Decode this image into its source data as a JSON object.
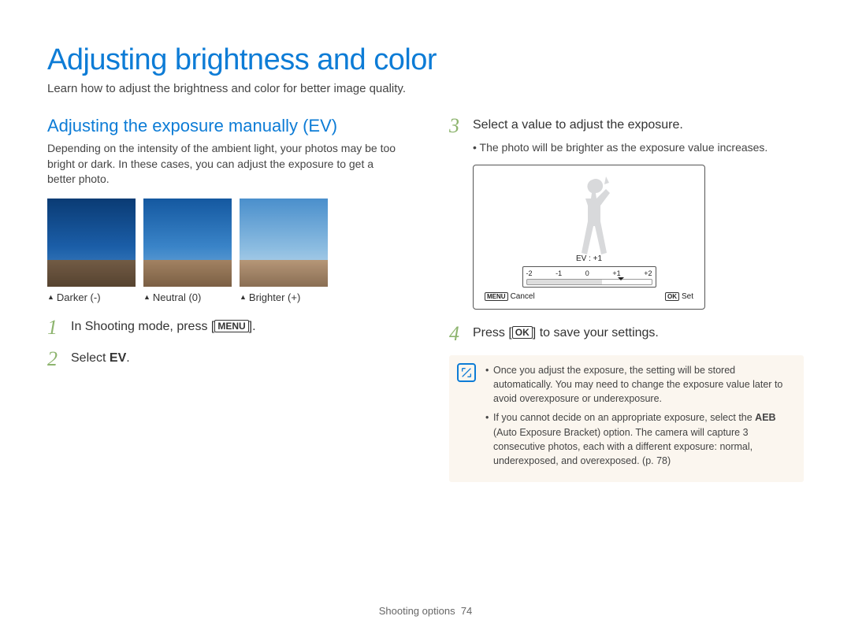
{
  "title": "Adjusting brightness and color",
  "intro": "Learn how to adjust the brightness and color for better image quality.",
  "left": {
    "section_title": "Adjusting the exposure manually (EV)",
    "desc": "Depending on the intensity of the ambient light, your photos may be too bright or dark. In these cases, you can adjust the exposure to get a better photo.",
    "captions": {
      "darker": "Darker (-)",
      "neutral": "Neutral (0)",
      "brighter": "Brighter (+)"
    },
    "step1": {
      "num": "1",
      "pre": "In Shooting mode, press [",
      "btn": "MENU",
      "post": "]."
    },
    "step2": {
      "num": "2",
      "pre": "Select ",
      "bold": "EV",
      "post": "."
    }
  },
  "right": {
    "step3": {
      "num": "3",
      "text": "Select a value to adjust the exposure.",
      "bullet": "The photo will be brighter as the exposure value increases."
    },
    "screen": {
      "ev_label": "EV : +1",
      "ticks": [
        "-2",
        "-1",
        "0",
        "+1",
        "+2"
      ],
      "cancel_btn": "MENU",
      "cancel": "Cancel",
      "set_btn": "OK",
      "set": "Set"
    },
    "step4": {
      "num": "4",
      "pre": "Press [",
      "btn": "OK",
      "post": "] to save your settings."
    },
    "note": {
      "item1": "Once you adjust the exposure, the setting will be stored automatically. You may need to change the exposure value later to avoid overexposure or underexposure.",
      "item2_a": "If you cannot decide on an appropriate exposure, select the ",
      "item2_bold": "AEB",
      "item2_b": " (Auto Exposure Bracket) option. The camera will capture 3 consecutive photos, each with a different exposure: normal, underexposed, and overexposed. (p. 78)"
    }
  },
  "footer": {
    "section": "Shooting options",
    "page": "74"
  }
}
